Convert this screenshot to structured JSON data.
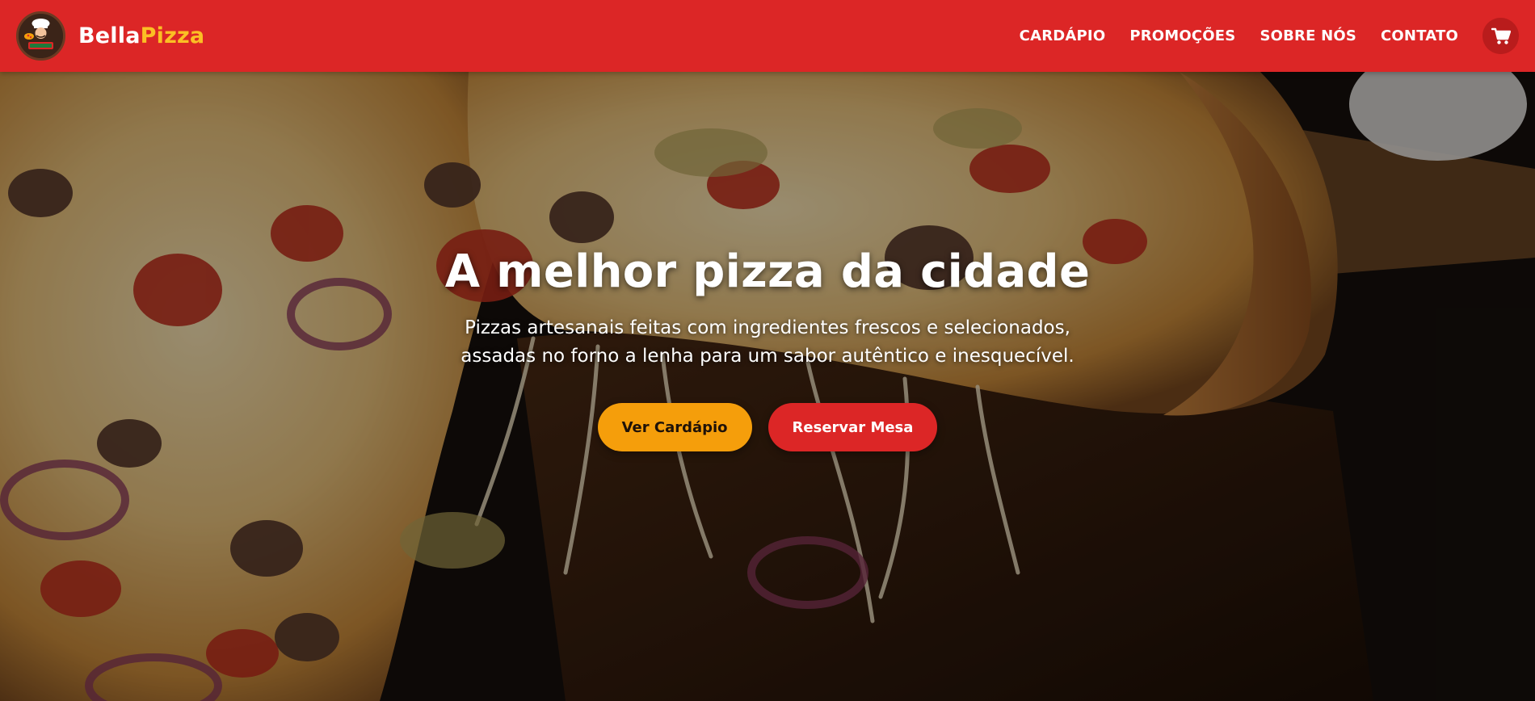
{
  "brand": {
    "part1": "Bella",
    "part2": "Pizza",
    "logo_icon": "chef-pizza-logo",
    "logo_text": "ITALIAN"
  },
  "nav": {
    "items": [
      {
        "label": "CARDÁPIO"
      },
      {
        "label": "PROMOÇÕES"
      },
      {
        "label": "SOBRE NÓS"
      },
      {
        "label": "CONTATO"
      }
    ],
    "cart_icon": "shopping-cart-icon"
  },
  "hero": {
    "title": "A melhor pizza da cidade",
    "subtitle": "Pizzas artesanais feitas com ingredientes frescos e selecionados, assadas no forno a lenha para um sabor autêntico e inesquecível.",
    "primary_button": "Ver Cardápio",
    "secondary_button": "Reservar Mesa",
    "background": "pizza-photo"
  },
  "colors": {
    "header_bg": "#dc2626",
    "brand_accent": "#fbbf24",
    "primary_button": "#f59e0b",
    "secondary_button": "#dc2626"
  }
}
